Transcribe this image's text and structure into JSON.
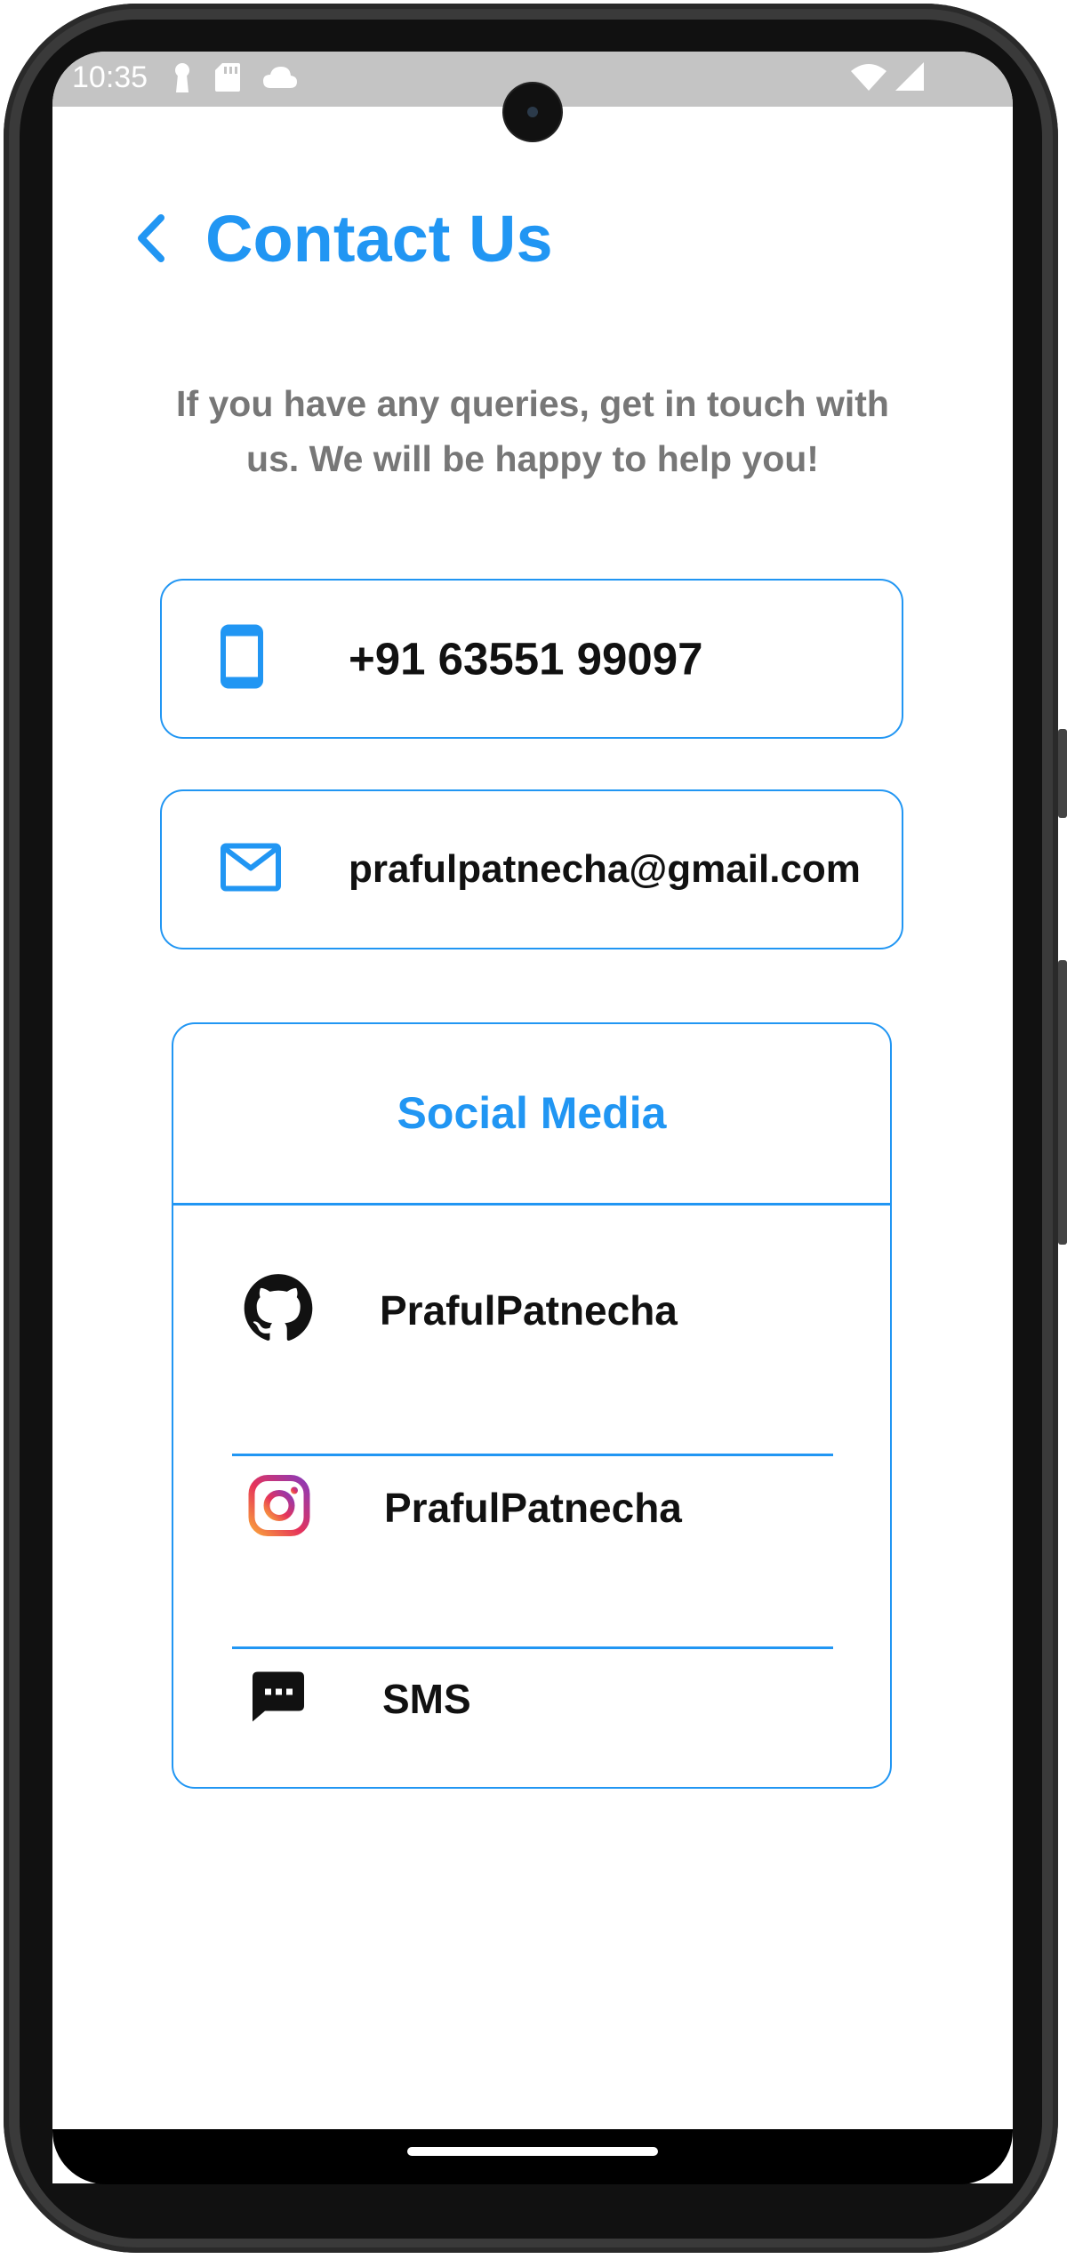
{
  "status_bar": {
    "time": "10:35"
  },
  "header": {
    "title": "Contact Us"
  },
  "intro_text": "If you have any queries, get in touch with us. We will be happy to help you!",
  "contacts": {
    "phone": "+91 63551 99097",
    "email": "prafulpatnecha@gmail.com"
  },
  "social": {
    "title": "Social Media",
    "items": [
      {
        "icon": "github-icon",
        "label": "PrafulPatnecha"
      },
      {
        "icon": "instagram-icon",
        "label": "PrafulPatnecha"
      },
      {
        "icon": "sms-icon",
        "label": "SMS"
      }
    ]
  },
  "colors": {
    "accent": "#2196f3",
    "muted_text": "#777777",
    "body_text": "#111111"
  }
}
